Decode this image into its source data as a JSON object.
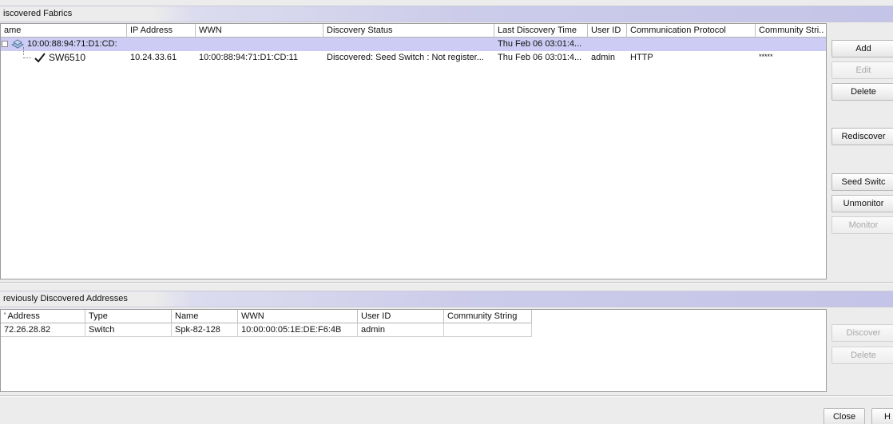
{
  "fabrics_panel": {
    "title": "iscovered Fabrics",
    "columns": [
      "ame",
      "IP Address",
      "WWN",
      "Discovery Status",
      "Last Discovery Time",
      "User ID",
      "Communication Protocol",
      "Community Stri.."
    ],
    "fabric_row": {
      "name": "10:00:88:94:71:D1:CD:",
      "last_discovery_time": "Thu Feb 06 03:01:4..."
    },
    "switch_row": {
      "name": "SW6510",
      "ip": "10.24.33.61",
      "wwn": "10:00:88:94:71:D1:CD:11",
      "status": "Discovered: Seed Switch : Not register...",
      "last_discovery_time": "Thu Feb 06 03:01:4...",
      "user_id": "admin",
      "protocol": "HTTP",
      "community": "*****"
    },
    "buttons": {
      "add": "Add",
      "edit": "Edit",
      "delete": "Delete",
      "rediscover": "Rediscover",
      "seed_switch": "Seed Switc",
      "unmonitor": "Unmonitor",
      "monitor": "Monitor"
    }
  },
  "previous_panel": {
    "title": "reviously Discovered Addresses",
    "columns": [
      "' Address",
      "Type",
      "Name",
      "WWN",
      "User ID",
      "Community String"
    ],
    "rows": [
      {
        "ip": "72.26.28.82",
        "type": "Switch",
        "name": "Spk-82-128",
        "wwn": "10:00:00:05:1E:DE:F6:4B",
        "user_id": "admin",
        "community": ""
      }
    ],
    "buttons": {
      "discover": "Discover",
      "delete": "Delete"
    }
  },
  "footer": {
    "close": "Close",
    "help": "H"
  },
  "colors": {
    "selected_row": "#ccccf4",
    "header_gradient_end": "#c4c4e8",
    "check_color": "#1a1a1a"
  }
}
